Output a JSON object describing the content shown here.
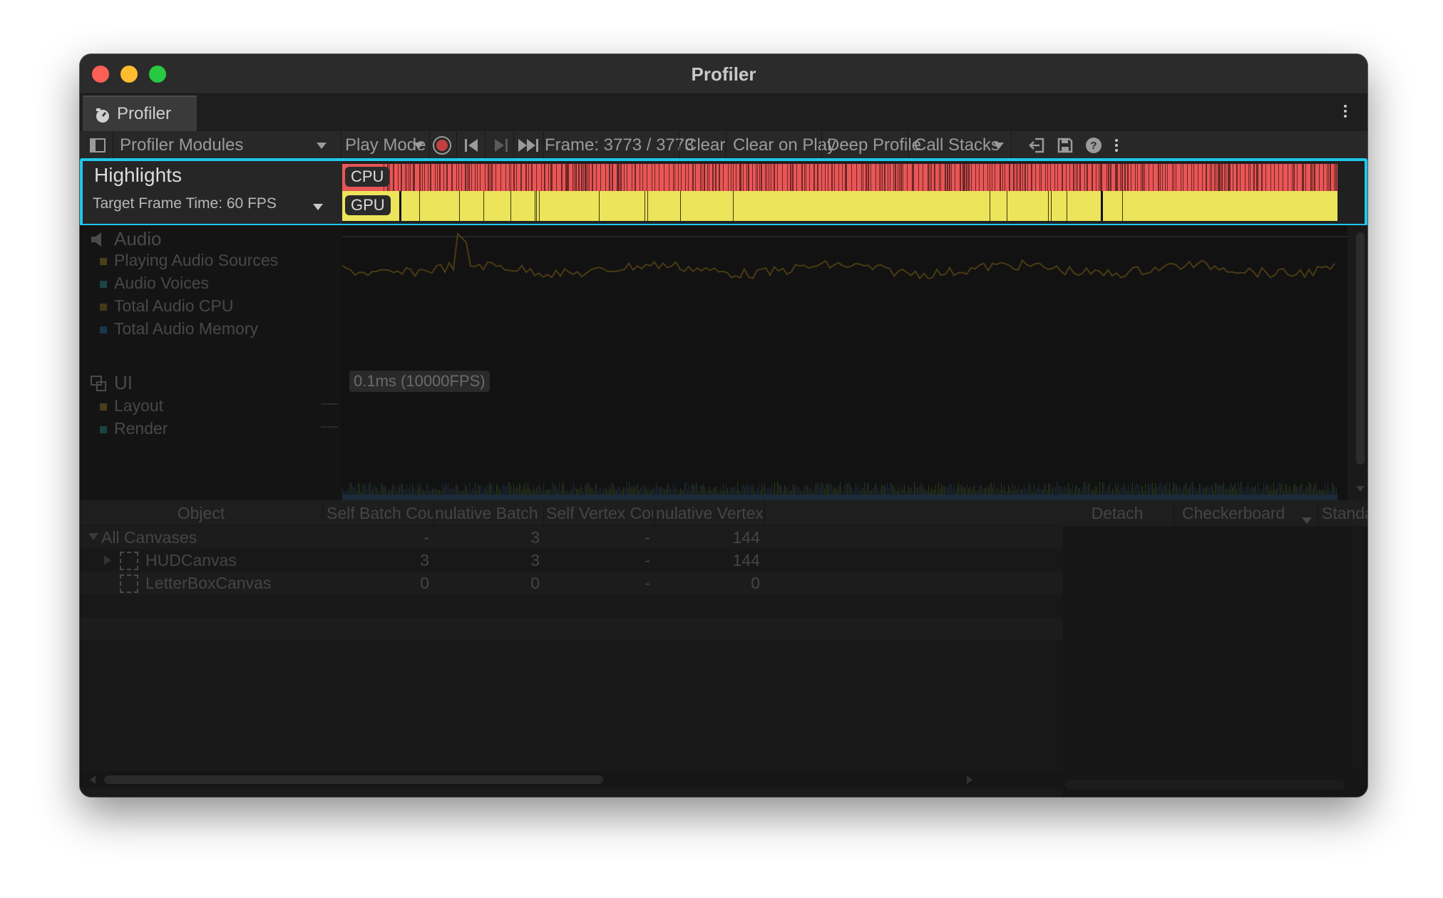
{
  "window": {
    "title": "Profiler"
  },
  "tab": {
    "label": "Profiler"
  },
  "toolbar": {
    "modules_label": "Profiler Modules",
    "play_mode_label": "Play Mode",
    "frame_label": "Frame: 3773 / 3773",
    "clear_label": "Clear",
    "clear_on_play_label": "Clear on Play",
    "deep_profile_label": "Deep Profile",
    "call_stacks_label": "Call Stacks"
  },
  "highlights": {
    "title": "Highlights",
    "target_frame_time": "Target Frame Time: 60 FPS",
    "cpu_label": "CPU",
    "gpu_label": "GPU",
    "cpu_color": "#e85656",
    "gpu_color": "#ece45a",
    "highlight_color": "#1fc8ea"
  },
  "audio_module": {
    "title": "Audio",
    "stats": [
      {
        "label": "Playing Audio Sources",
        "color": "#5a4a1a"
      },
      {
        "label": "Audio Voices",
        "color": "#1a4a4a"
      },
      {
        "label": "Total Audio CPU",
        "color": "#4a3a1a"
      },
      {
        "label": "Total Audio Memory",
        "color": "#1a3a4a"
      }
    ]
  },
  "ui_module": {
    "title": "UI",
    "fps_badge": "0.1ms (10000FPS)",
    "stats": [
      {
        "label": "Layout",
        "color": "#5a4a1a"
      },
      {
        "label": "Render",
        "color": "#1a4a4a"
      }
    ]
  },
  "table": {
    "columns": [
      "Object",
      "Self Batch Count",
      "nulative Batch Cc",
      "Self Vertex Coun",
      "nulative Vertex C"
    ],
    "rows": [
      {
        "name": "All Canvases",
        "self_batch": "-",
        "cum_batch": "3",
        "self_vertex": "-",
        "cum_vertex": "144"
      },
      {
        "name": "HUDCanvas",
        "self_batch": "3",
        "cum_batch": "3",
        "self_vertex": "-",
        "cum_vertex": "144"
      },
      {
        "name": "LetterBoxCanvas",
        "self_batch": "0",
        "cum_batch": "0",
        "self_vertex": "-",
        "cum_vertex": "0"
      }
    ]
  },
  "preview": {
    "detach_label": "Detach",
    "checkerboard_label": "Checkerboard",
    "standard_label": "Standard"
  }
}
